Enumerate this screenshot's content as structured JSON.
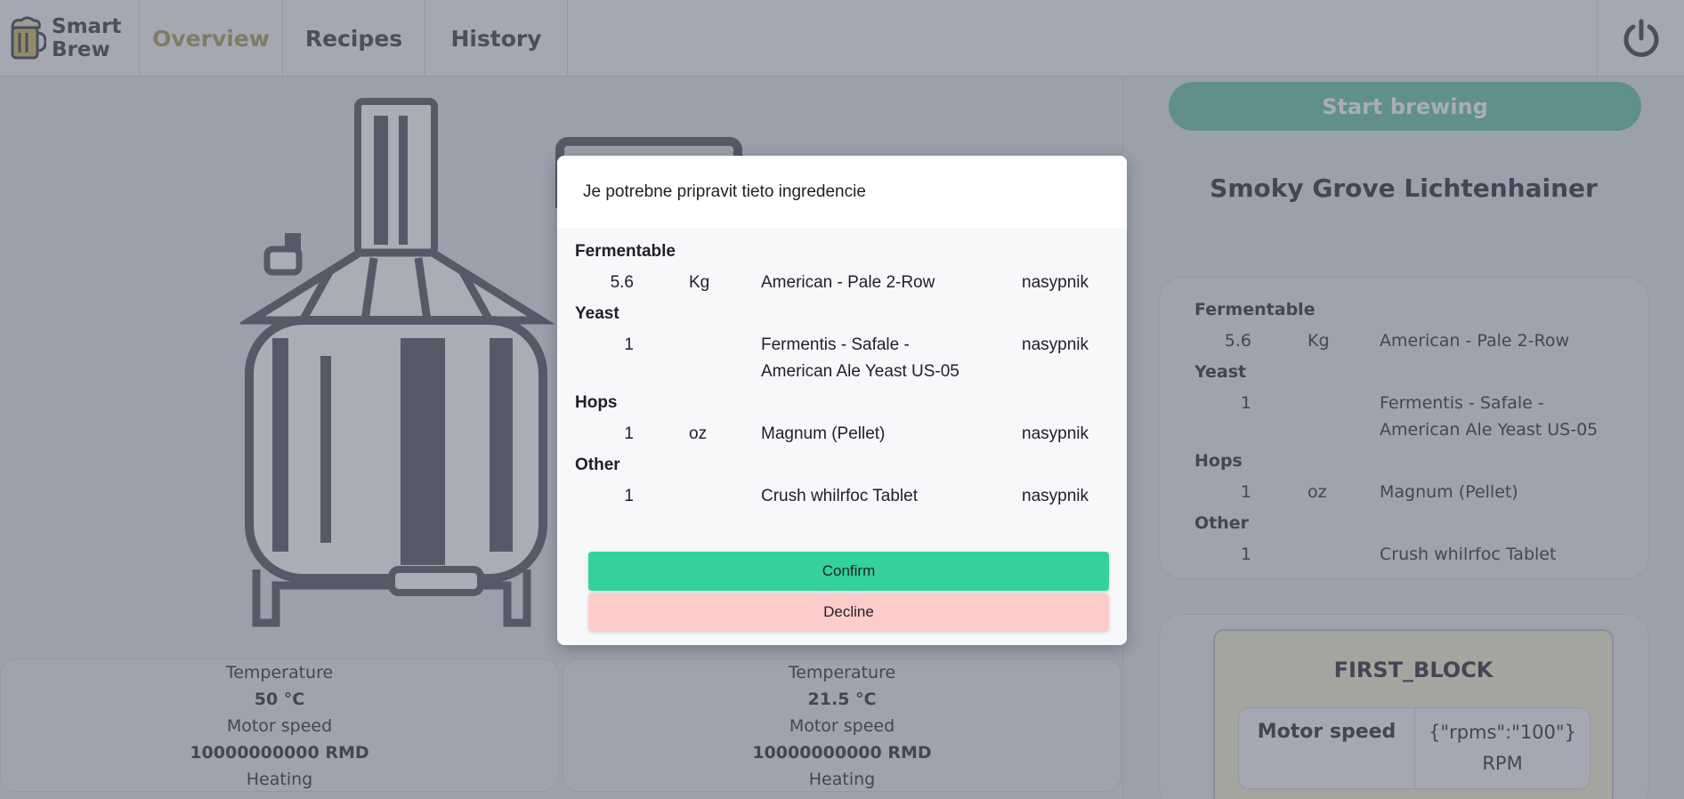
{
  "app": {
    "logo_line1": "Smart",
    "logo_line2": "Brew"
  },
  "nav": {
    "tabs": [
      "Overview",
      "Recipes",
      "History"
    ]
  },
  "stats": [
    {
      "temp_label": "Temperature",
      "temp_value": "50 °C",
      "motor_label": "Motor speed",
      "motor_value": "10000000000 RMD",
      "heating_label": "Heating"
    },
    {
      "temp_label": "Temperature",
      "temp_value": "21.5 °C",
      "motor_label": "Motor speed",
      "motor_value": "10000000000 RMD",
      "heating_label": "Heating"
    }
  ],
  "right": {
    "start_label": "Start brewing",
    "recipe_title": "Smoky Grove Lichtenhainer",
    "ingredients": {
      "fermentable_label": "Fermentable",
      "fermentable": {
        "amount": "5.6",
        "unit": "Kg",
        "name": "American - Pale 2-Row"
      },
      "yeast_label": "Yeast",
      "yeast": {
        "amount": "1",
        "unit": "",
        "name_line1": "Fermentis - Safale -",
        "name_line2": "American Ale Yeast US-05"
      },
      "hops_label": "Hops",
      "hops": {
        "amount": "1",
        "unit": "oz",
        "name": "Magnum (Pellet)"
      },
      "other_label": "Other",
      "other": {
        "amount": "1",
        "unit": "",
        "name": "Crush whilrfoc Tablet"
      }
    },
    "block": {
      "title": "FIRST_BLOCK",
      "row_label": "Motor speed",
      "row_value_line1": "{\"rpms\":\"100\"}",
      "row_value_line2": "RPM"
    }
  },
  "modal": {
    "title": "Je potrebne pripravit tieto ingredencie",
    "fermentable_label": "Fermentable",
    "fermentable": {
      "amount": "5.6",
      "unit": "Kg",
      "name": "American - Pale 2-Row",
      "where": "nasypnik"
    },
    "yeast_label": "Yeast",
    "yeast": {
      "amount": "1",
      "name_line1": "Fermentis - Safale -",
      "name_line2": "American Ale Yeast US-05",
      "where": "nasypnik"
    },
    "hops_label": "Hops",
    "hops": {
      "amount": "1",
      "unit": "oz",
      "name": "Magnum (Pellet)",
      "where": "nasypnik"
    },
    "other_label": "Other",
    "other": {
      "amount": "1",
      "name": "Crush whilrfoc Tablet",
      "where": "nasypnik"
    },
    "confirm_label": "Confirm",
    "decline_label": "Decline"
  },
  "colors": {
    "accent_green": "#35d19a",
    "decline_pink": "#ffcccc",
    "active_tab": "#b7a972",
    "start_button": "#7fcbb7"
  },
  "icons": {
    "logo": "beer-mug-icon",
    "power": "power-icon"
  }
}
